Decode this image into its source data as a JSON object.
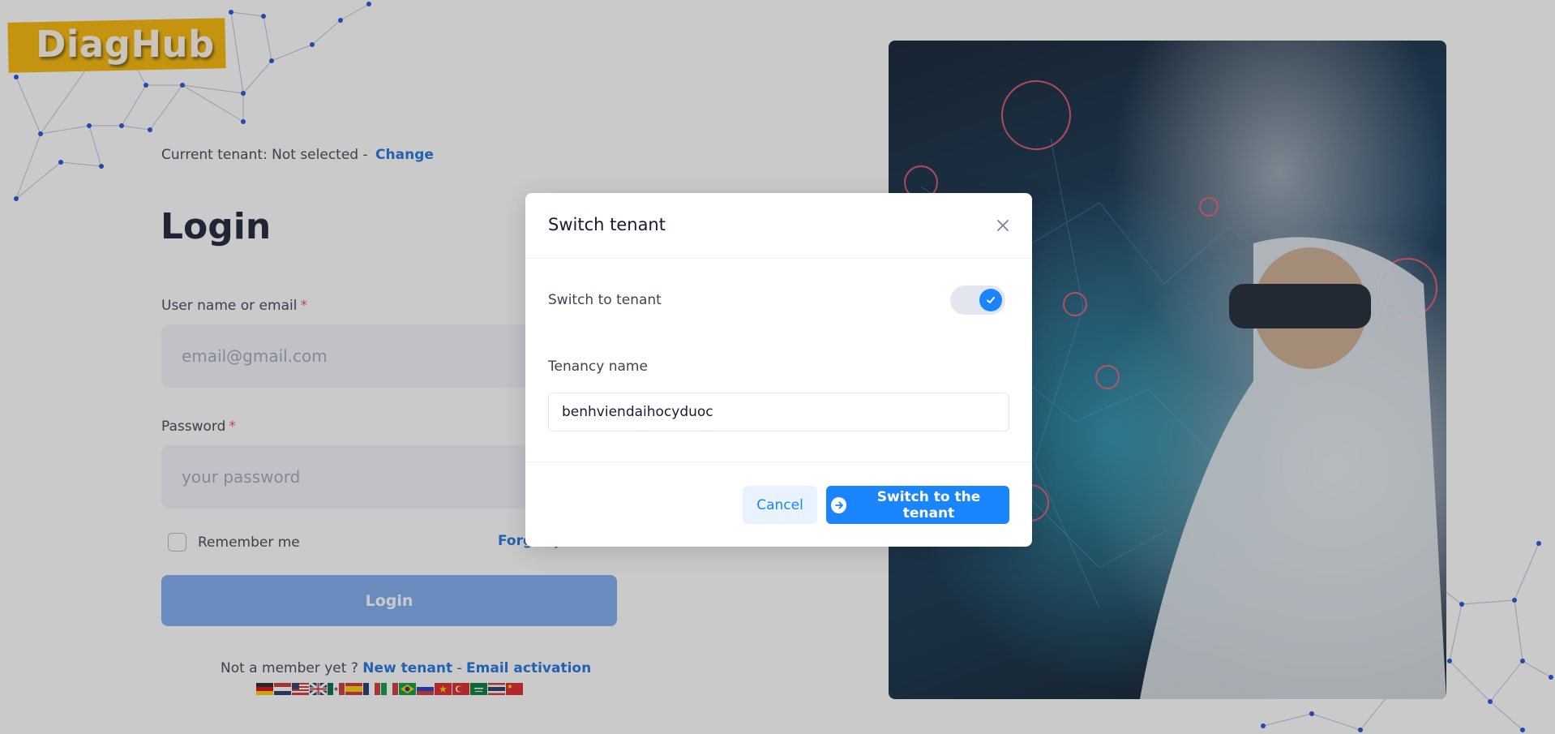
{
  "brand": {
    "logo_text": "DiagHub"
  },
  "tenant": {
    "prefix": "Current tenant: Not selected -",
    "change_label": "Change"
  },
  "login": {
    "title": "Login",
    "username_label": "User name or email",
    "username_placeholder": "email@gmail.com",
    "password_label": "Password",
    "password_placeholder": "your password",
    "required_mark": "*",
    "remember_label": "Remember me",
    "forgot_label": "Forgot password?",
    "submit_label": "Login"
  },
  "register": {
    "prompt": "Not a member yet ?",
    "new_tenant_label": "New tenant",
    "separator": "-",
    "email_activation_label": "Email activation"
  },
  "languages": [
    "german",
    "dutch",
    "english-us",
    "english-uk",
    "mexican-spanish",
    "spanish",
    "french",
    "italian",
    "portuguese-brazil",
    "russian",
    "vietnamese",
    "turkish",
    "arabic",
    "thai",
    "chinese"
  ],
  "modal": {
    "title": "Switch tenant",
    "switch_label": "Switch to tenant",
    "switch_on": true,
    "tenancy_label": "Tenancy name",
    "tenancy_value": "benhviendaihocyduoc",
    "cancel_label": "Cancel",
    "confirm_label": "Switch to the tenant"
  },
  "colors": {
    "accent": "#1b84ff",
    "logo_bg": "#f7b500",
    "link": "#1b6fe0"
  }
}
